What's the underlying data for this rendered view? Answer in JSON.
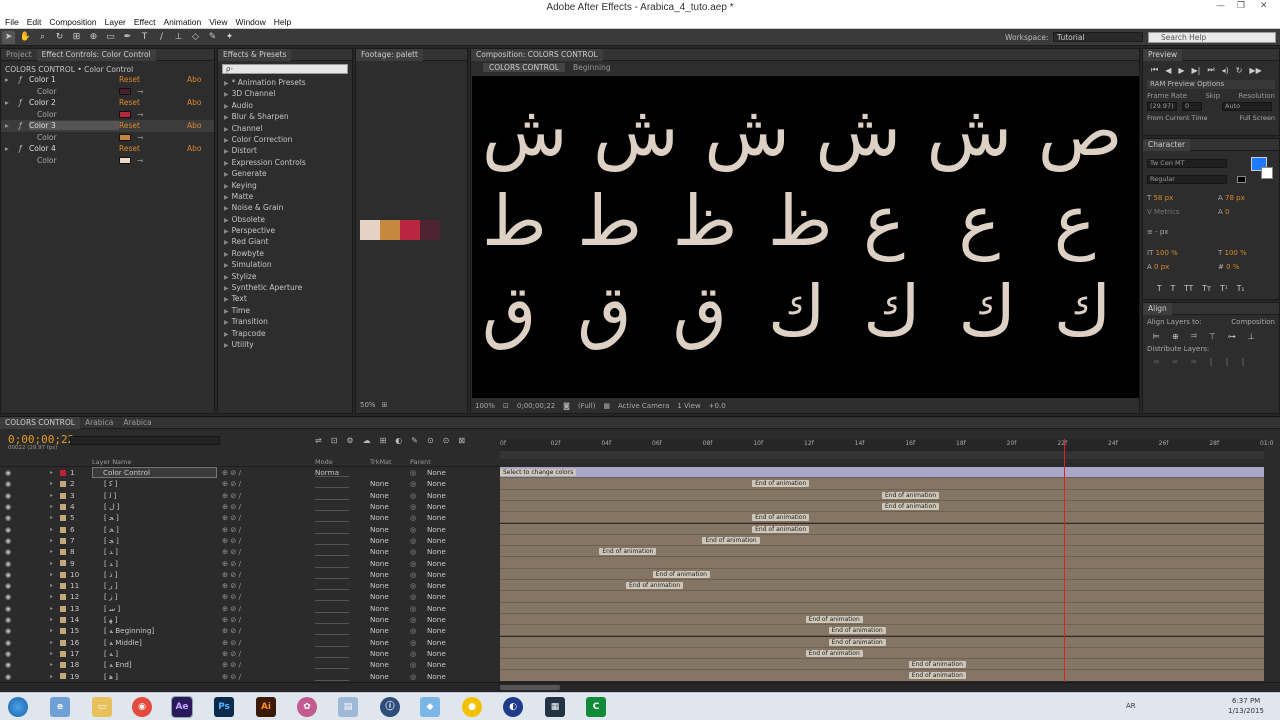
{
  "window": {
    "title": "Adobe After Effects - Arabica_4_tuto.aep *"
  },
  "menu": [
    "File",
    "Edit",
    "Composition",
    "Layer",
    "Effect",
    "Animation",
    "View",
    "Window",
    "Help"
  ],
  "toolbar": {
    "workspace_label": "Workspace:",
    "workspace_value": "Tutorial",
    "search_placeholder": "Search Help"
  },
  "left_panel": {
    "tabs": [
      "Project",
      "Effect Controls: Color Control"
    ],
    "header": "COLORS CONTROL • Color Control",
    "effects": [
      {
        "name": "Color 1",
        "reset": "Reset",
        "about": "Abo",
        "sub": "Color",
        "swatch": "#4a1f2f"
      },
      {
        "name": "Color 2",
        "reset": "Reset",
        "about": "Abo",
        "sub": "Color",
        "swatch": "#b5263f"
      },
      {
        "name": "Color 3",
        "reset": "Reset",
        "about": "Abo",
        "sub": "Color",
        "swatch": "#c8843d"
      },
      {
        "name": "Color 4",
        "reset": "Reset",
        "about": "Abo",
        "sub": "Color",
        "swatch": "#ead8c8"
      }
    ]
  },
  "effects_presets": {
    "title": "Effects & Presets",
    "search_value": "ρ-",
    "items": [
      "* Animation Presets",
      "3D Channel",
      "Audio",
      "Blur & Sharpen",
      "Channel",
      "Color Correction",
      "Distort",
      "Expression Controls",
      "Generate",
      "Keying",
      "Matte",
      "Noise & Grain",
      "Obsolete",
      "Perspective",
      "Red Giant",
      "Rowbyte",
      "Simulation",
      "Stylize",
      "Synthetic Aperture",
      "Text",
      "Time",
      "Transition",
      "Trapcode",
      "Utility"
    ]
  },
  "footage": {
    "tab": "Footage: palett",
    "zoom": "50%",
    "palette": [
      "#e6d2c4",
      "#c6873f",
      "#b8263f",
      "#4e2332"
    ]
  },
  "composition": {
    "tab": "Composition: COLORS CONTROL",
    "breadcrumb_1": "COLORS CONTROL",
    "breadcrumb_2": "Beginning",
    "rows": [
      [
        "ش",
        "ش",
        "ش",
        "ش",
        "ش",
        "ص"
      ],
      [
        "ط",
        "ط",
        "ظ",
        "ظ",
        "ع",
        "ع",
        "ع"
      ],
      [
        "ق",
        "ق",
        "ق",
        "ك",
        "ك",
        "ك",
        "ك"
      ]
    ],
    "footer": {
      "zoom": "100%",
      "time": "0;00;00;22",
      "resolution": "(Full)",
      "camera": "Active Camera",
      "view": "1 View",
      "offset": "+0.0"
    }
  },
  "right_panel": {
    "preview_tab": "Preview",
    "ram_preview": "RAM Preview Options",
    "frame_rate_label": "Frame Rate",
    "skip_label": "Skip",
    "resolution_label": "Resolution",
    "frame_rate": "(29.97)",
    "skip": "0",
    "resolution": "Auto",
    "from_current": "From Current Time",
    "full_screen": "Full Screen",
    "character_tab": "Character",
    "font": "Tw Cen MT",
    "style": "Regular",
    "size": "58 px",
    "leading": "78 px",
    "tracking": "Metrics",
    "kern": "0",
    "px_label": "- px",
    "vscale": "100 %",
    "hscale": "100 %",
    "baseline": "0 px",
    "tsume": "0 %",
    "align_tab": "Align",
    "align_to_label": "Align Layers to:",
    "align_to": "Composition",
    "distribute_label": "Distribute Layers:"
  },
  "timeline": {
    "tabs": [
      "COLORS CONTROL",
      "Arabica",
      "Arabica"
    ],
    "current_time": "0;00;00;22",
    "fps_note": "00022 (29.97 fps)",
    "col_layer_name": "Layer Name",
    "col_mode": "Mode",
    "col_trkmat": "TrkMat",
    "col_parent": "Parent",
    "ruler": [
      "0f",
      "02f",
      "04f",
      "06f",
      "08f",
      "10f",
      "12f",
      "14f",
      "16f",
      "18f",
      "20f",
      "22f",
      "24f",
      "26f",
      "28f",
      "01:0"
    ],
    "playhead_fraction": 0.738,
    "layers": [
      {
        "num": "1",
        "name": "Color Control",
        "mode": "Norma",
        "trk": "",
        "parent": "None",
        "marker": "Select to change colors",
        "mpos": 0.0
      },
      {
        "num": "2",
        "name": "[ ﻛ ]",
        "mode": "",
        "trk": "None",
        "parent": "None",
        "marker": "End of animation",
        "mpos": 0.33
      },
      {
        "num": "3",
        "name": "[ ﻟ ]",
        "mode": "",
        "trk": "None",
        "parent": "None",
        "marker": "End of animation",
        "mpos": 0.5
      },
      {
        "num": "4",
        "name": "[ ﻝ ]",
        "mode": "",
        "trk": "None",
        "parent": "None",
        "marker": "End of animation",
        "mpos": 0.5
      },
      {
        "num": "5",
        "name": "[ ﺤ ]",
        "mode": "",
        "trk": "None",
        "parent": "None",
        "marker": "End of animation",
        "mpos": 0.33
      },
      {
        "num": "6",
        "name": "[ ﺨ ]",
        "mode": "",
        "trk": "None",
        "parent": "None",
        "marker": "End of animation",
        "mpos": 0.33
      },
      {
        "num": "7",
        "name": "[ ﺠ ]",
        "mode": "",
        "trk": "None",
        "parent": "None",
        "marker": "End of animation",
        "mpos": 0.265
      },
      {
        "num": "8",
        "name": "[ ﺪ ]",
        "mode": "",
        "trk": "None",
        "parent": "None",
        "marker": "End of animation",
        "mpos": 0.13
      },
      {
        "num": "9",
        "name": "[ ﺪ ]",
        "mode": "",
        "trk": "None",
        "parent": "None",
        "marker": "",
        "mpos": 0
      },
      {
        "num": "10",
        "name": "[ ﺫ ]",
        "mode": "",
        "trk": "None",
        "parent": "None",
        "marker": "End of animation",
        "mpos": 0.2
      },
      {
        "num": "11",
        "name": "[ ﺭ ]",
        "mode": "",
        "trk": "None",
        "parent": "None",
        "marker": "End of animation",
        "mpos": 0.165
      },
      {
        "num": "12",
        "name": "[ ﺯ ]",
        "mode": "",
        "trk": "None",
        "parent": "None",
        "marker": "",
        "mpos": 0
      },
      {
        "num": "13",
        "name": "[ ﺳ ]",
        "mode": "",
        "trk": "None",
        "parent": "None",
        "marker": "",
        "mpos": 0
      },
      {
        "num": "14",
        "name": "[ ﻬ ]",
        "mode": "",
        "trk": "None",
        "parent": "None",
        "marker": "End of animation",
        "mpos": 0.4
      },
      {
        "num": "15",
        "name": "[ ﻪ Beginning]",
        "mode": "",
        "trk": "None",
        "parent": "None",
        "marker": "End of animation",
        "mpos": 0.43
      },
      {
        "num": "16",
        "name": "[ ﻪ Middle]",
        "mode": "",
        "trk": "None",
        "parent": "None",
        "marker": "End of animation",
        "mpos": 0.43
      },
      {
        "num": "17",
        "name": "[ ﻪ ]",
        "mode": "",
        "trk": "None",
        "parent": "None",
        "marker": "End of animation",
        "mpos": 0.4
      },
      {
        "num": "18",
        "name": "[ ﻪ End]",
        "mode": "",
        "trk": "None",
        "parent": "None",
        "marker": "End of animation",
        "mpos": 0.535
      },
      {
        "num": "19",
        "name": "[ ﻫ ]",
        "mode": "",
        "trk": "None",
        "parent": "None",
        "marker": "End of animation",
        "mpos": 0.535
      }
    ]
  },
  "taskbar": {
    "apps": [
      "Ae",
      "Ps",
      "Ai"
    ],
    "lang": "AR",
    "time": "6:37 PM",
    "date": "1/13/2015"
  }
}
